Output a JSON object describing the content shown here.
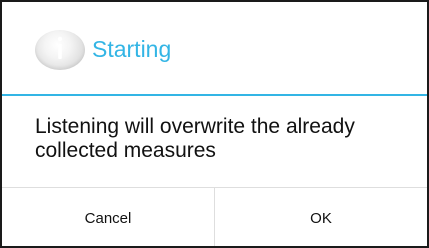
{
  "dialog": {
    "icon": "info-icon",
    "title": "Starting",
    "message": "Listening will overwrite the already collected measures",
    "buttons": {
      "cancel_label": "Cancel",
      "ok_label": "OK"
    }
  },
  "colors": {
    "accent": "#33b5e5",
    "text": "#111111",
    "divider": "#dedede",
    "border": "#1a1a1a"
  }
}
